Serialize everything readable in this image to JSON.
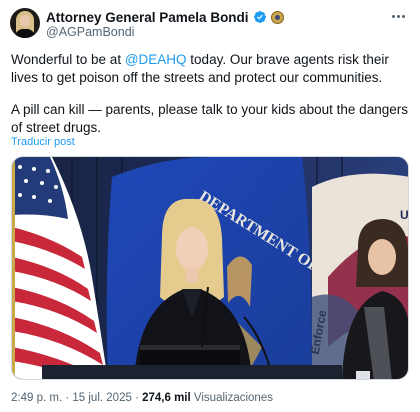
{
  "author": {
    "display_name": "Attorney General Pamela Bondi",
    "handle": "@AGPamBondi",
    "verified_icon": "verified-check-icon",
    "affiliation_icon": "government-seal-icon"
  },
  "tweet": {
    "line1_before": "Wonderful to be at ",
    "mention": "@DEAHQ",
    "line1_after": " today. Our brave agents risk their lives to get poison off the streets and protect our communities.",
    "paragraph2": "A pill can kill — parents, please talk to your kids about the dangers of street drugs.",
    "translate_label": "Traducir post"
  },
  "media": {
    "seal_text": "DEPARTMENT OF",
    "banner_text": "Enforce",
    "flag_corner_text": "U."
  },
  "meta": {
    "time": "2:49 p. m.",
    "separator": "·",
    "date": "15 jul. 2025",
    "views_count": "274,6 mil",
    "views_label": "Visualizaciones"
  },
  "colors": {
    "link": "#1d9bf0",
    "verified": "#1d9bf0",
    "secondary_text": "#536471"
  }
}
